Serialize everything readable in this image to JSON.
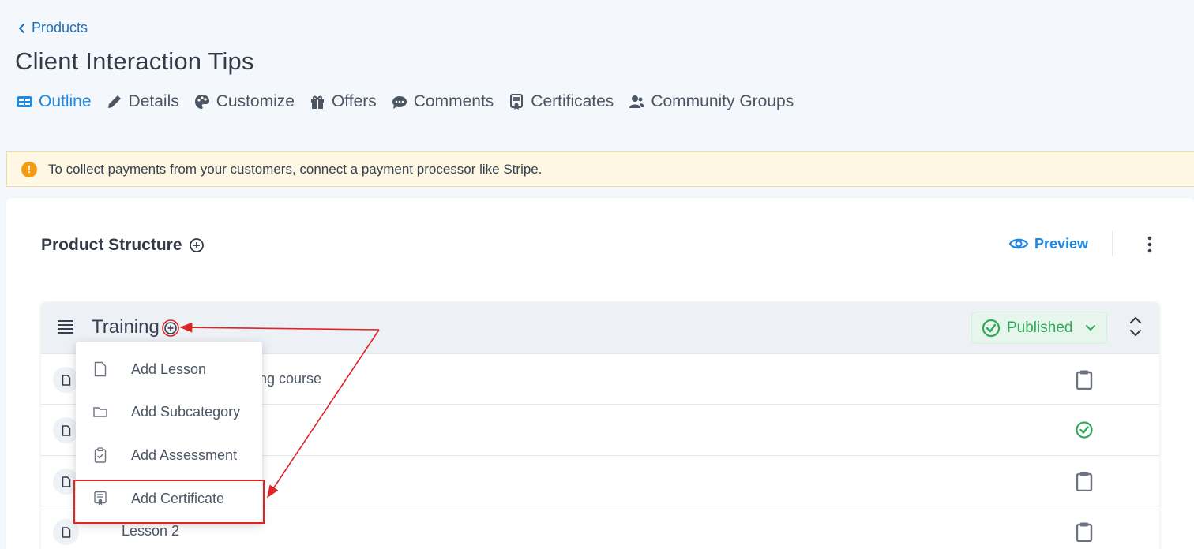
{
  "header": {
    "back_label": "Products",
    "title": "Client Interaction Tips",
    "tabs": [
      {
        "label": "Outline",
        "icon": "outline-icon",
        "active": true
      },
      {
        "label": "Details",
        "icon": "pencil-icon"
      },
      {
        "label": "Customize",
        "icon": "palette-icon"
      },
      {
        "label": "Offers",
        "icon": "gift-icon"
      },
      {
        "label": "Comments",
        "icon": "comment-icon"
      },
      {
        "label": "Certificates",
        "icon": "certificate-icon"
      },
      {
        "label": "Community Groups",
        "icon": "users-icon"
      }
    ]
  },
  "alert": {
    "text": "To collect payments from your customers, connect a payment processor like Stripe.",
    "icon": "warning-icon",
    "color": "#f39c12"
  },
  "structure": {
    "title": "Product Structure",
    "preview_label": "Preview",
    "accent_color": "#1e88e5"
  },
  "category": {
    "title": "Training",
    "status": "Published",
    "status_color": "#2fa85a",
    "rows": [
      {
        "text": "ing course",
        "status_icon": "clipboard-icon"
      },
      {
        "text": "",
        "status_icon": "check-circle-icon"
      },
      {
        "text": "",
        "status_icon": "clipboard-icon"
      },
      {
        "text": "Lesson 2",
        "status_icon": "clipboard-icon"
      }
    ]
  },
  "menu": {
    "items": [
      {
        "label": "Add Lesson",
        "icon": "file-icon"
      },
      {
        "label": "Add Subcategory",
        "icon": "folder-icon"
      },
      {
        "label": "Add Assessment",
        "icon": "clipboard-check-icon"
      },
      {
        "label": "Add Certificate",
        "icon": "certificate-icon",
        "highlighted": true
      }
    ]
  },
  "annotation": {
    "color": "#e02424"
  }
}
